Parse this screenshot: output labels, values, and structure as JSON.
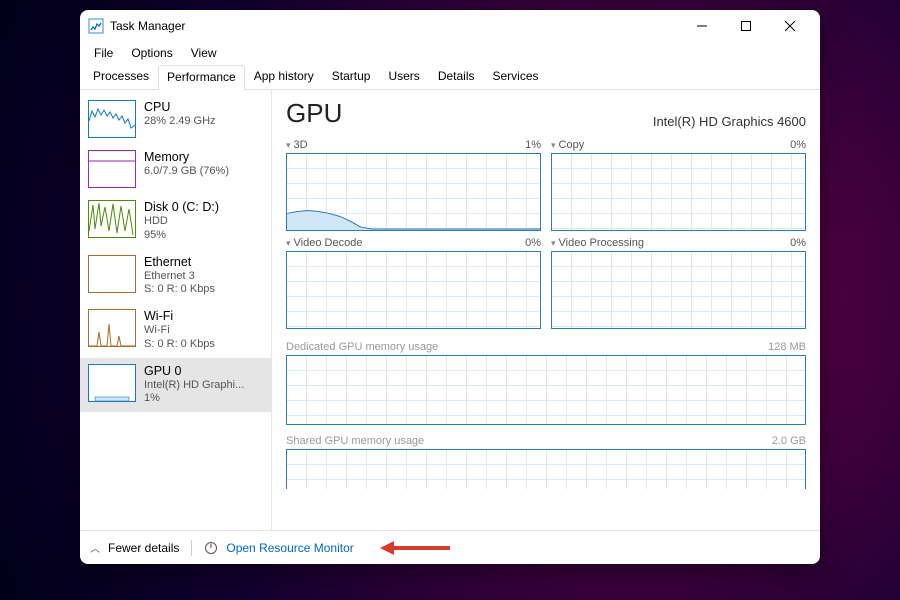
{
  "window": {
    "title": "Task Manager"
  },
  "menu": {
    "file": "File",
    "options": "Options",
    "view": "View"
  },
  "tabs": {
    "processes": "Processes",
    "performance": "Performance",
    "app_history": "App history",
    "startup": "Startup",
    "users": "Users",
    "details": "Details",
    "services": "Services"
  },
  "sidebar": [
    {
      "title": "CPU",
      "line2": "28% 2.49 GHz"
    },
    {
      "title": "Memory",
      "line2": "6.0/7.9 GB (76%)"
    },
    {
      "title": "Disk 0 (C: D:)",
      "line2": "HDD",
      "line3": "95%"
    },
    {
      "title": "Ethernet",
      "line2": "Ethernet 3",
      "line3": "S: 0 R: 0 Kbps"
    },
    {
      "title": "Wi-Fi",
      "line2": "Wi-Fi",
      "line3": "S: 0 R: 0 Kbps"
    },
    {
      "title": "GPU 0",
      "line2": "Intel(R) HD Graphi...",
      "line3": "1%"
    }
  ],
  "main": {
    "title": "GPU",
    "subtitle": "Intel(R) HD Graphics 4600",
    "charts": [
      {
        "name": "3D",
        "value": "1%"
      },
      {
        "name": "Copy",
        "value": "0%"
      },
      {
        "name": "Video Decode",
        "value": "0%"
      },
      {
        "name": "Video Processing",
        "value": "0%"
      }
    ],
    "mem1_label": "Dedicated GPU memory usage",
    "mem1_value": "128 MB",
    "mem2_label": "Shared GPU memory usage",
    "mem2_value": "2.0 GB"
  },
  "footer": {
    "fewer": "Fewer details",
    "rm": "Open Resource Monitor"
  },
  "chart_data": {
    "type": "line",
    "title": "GPU 3D utilization",
    "ylabel": "%",
    "ylim": [
      0,
      100
    ],
    "x": [
      0,
      1,
      2,
      3,
      4,
      5,
      6,
      7,
      8,
      9,
      10,
      11,
      12,
      13,
      14,
      15,
      16,
      17,
      18,
      19,
      20,
      21,
      22,
      23
    ],
    "values": [
      22,
      24,
      26,
      24,
      22,
      18,
      12,
      4,
      1,
      1,
      1,
      1,
      1,
      1,
      1,
      1,
      1,
      1,
      1,
      1,
      1,
      1,
      1,
      1
    ]
  }
}
